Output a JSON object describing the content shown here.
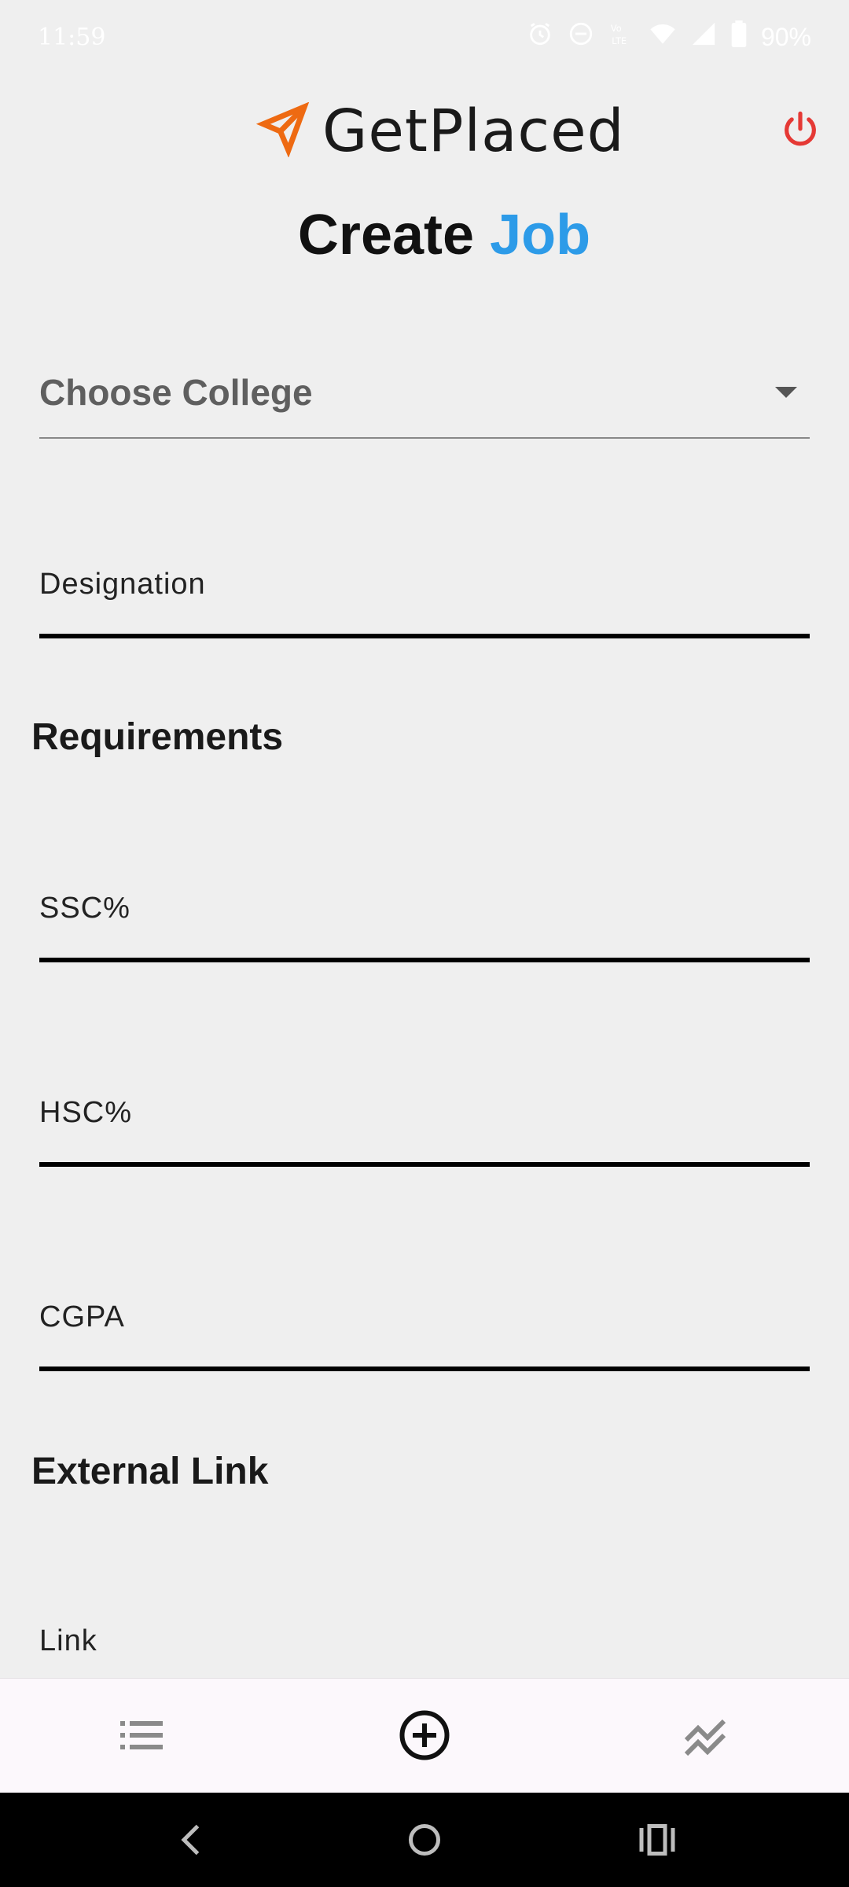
{
  "status_bar": {
    "time": "11:59",
    "battery": "90%",
    "icons": [
      "alarm-icon",
      "do-not-disturb-icon",
      "volte-icon",
      "wifi-icon",
      "cell-signal-icon",
      "battery-icon"
    ]
  },
  "header": {
    "app_name": "GetPlaced",
    "logo_icon": "paper-plane-icon",
    "power_icon": "power-icon",
    "title_prefix": "Create",
    "title_accent": "Job"
  },
  "form": {
    "college_select": {
      "placeholder": "Choose College"
    },
    "designation": {
      "label": "Designation",
      "value": ""
    },
    "requirements_heading": "Requirements",
    "ssc": {
      "label": "SSC%",
      "value": ""
    },
    "hsc": {
      "label": "HSC%",
      "value": ""
    },
    "cgpa": {
      "label": "CGPA",
      "value": ""
    },
    "external_heading": "External Link",
    "link": {
      "label": "Link",
      "value": ""
    }
  },
  "bottom_nav": {
    "items": [
      {
        "icon": "list-icon"
      },
      {
        "icon": "add-circle-icon"
      },
      {
        "icon": "trending-chart-icon"
      }
    ]
  },
  "colors": {
    "accent": "#2d9be8",
    "logo": "#ee6a12",
    "power": "#e53935",
    "background": "#efefef"
  }
}
